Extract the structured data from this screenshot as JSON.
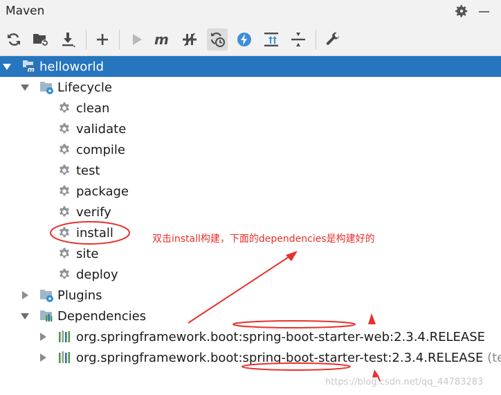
{
  "panel": {
    "title": "Maven"
  },
  "toolbar": {
    "buttons": [
      {
        "name": "reload-all-projects",
        "icon": "refresh-icon"
      },
      {
        "name": "generate-sources",
        "icon": "folder-refresh-icon"
      },
      {
        "name": "download-sources",
        "icon": "download-icon"
      },
      {
        "name": "add-maven-project",
        "icon": "plus-icon"
      },
      {
        "name": "run-maven-build",
        "icon": "play-icon"
      },
      {
        "name": "execute-maven-goal",
        "icon": "m-icon"
      },
      {
        "name": "toggle-offline-mode",
        "icon": "offline-icon"
      },
      {
        "name": "skip-tests",
        "icon": "skip-tests-icon"
      },
      {
        "name": "show-dependencies",
        "icon": "lightning-icon"
      },
      {
        "name": "collapse-all",
        "icon": "collapse-icon"
      },
      {
        "name": "expand-all",
        "icon": "expand-icon"
      },
      {
        "name": "maven-settings",
        "icon": "wrench-icon"
      }
    ]
  },
  "tree": {
    "project": "helloworld",
    "lifecycle": {
      "label": "Lifecycle",
      "phases": [
        "clean",
        "validate",
        "compile",
        "test",
        "package",
        "verify",
        "install",
        "site",
        "deploy"
      ]
    },
    "plugins": {
      "label": "Plugins"
    },
    "dependencies": {
      "label": "Dependencies",
      "items": [
        {
          "text": "org.springframework.boot:spring-boot-starter-web:2.3.4.RELEASE",
          "scope": ""
        },
        {
          "text": "org.springframework.boot:spring-boot-starter-test:2.3.4.RELEASE",
          "scope": "(test)"
        }
      ]
    }
  },
  "annotation": {
    "text": "双击install构建，下面的dependencies是构建好的"
  },
  "watermark": "https://blog.csdn.net/qq_44783283",
  "colors": {
    "selection": "#2675bf",
    "annotation": "#e8302a",
    "folder": "#9fb7c9",
    "gear": "#8e9499"
  }
}
